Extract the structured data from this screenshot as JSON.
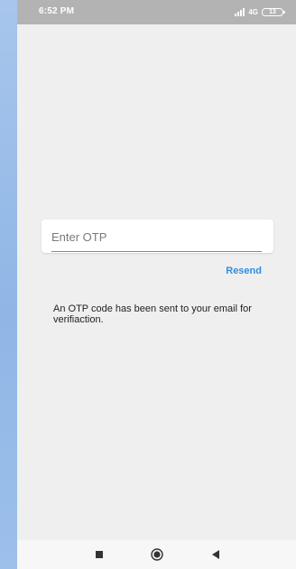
{
  "status_bar": {
    "time": "6:52 PM",
    "network": "4G",
    "battery": "13"
  },
  "otp_form": {
    "input_value": "",
    "input_placeholder": "Enter OTP",
    "resend_label": "Resend",
    "message": "An OTP code has been sent to your email for verifiaction."
  },
  "nav_bar": {
    "icons": [
      "recents-icon",
      "home-icon",
      "back-icon"
    ]
  },
  "colors": {
    "accent": "#2f8ee0",
    "background": "#efefef",
    "status_bar": "#b3b3b3"
  }
}
